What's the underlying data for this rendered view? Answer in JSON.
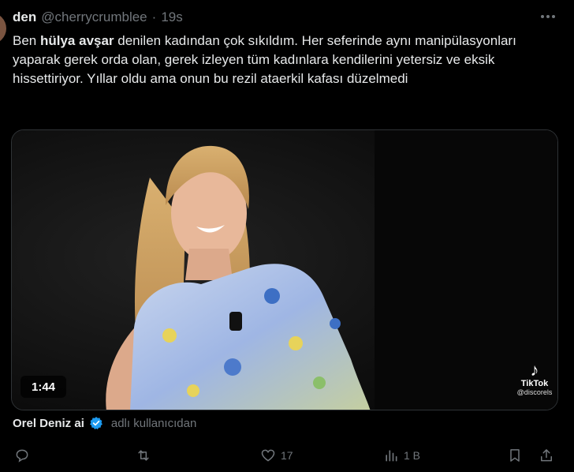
{
  "tweet": {
    "display_name": "den",
    "handle": "@cherrycrumblee",
    "separator": "·",
    "time": "19s",
    "text": {
      "intro": "Ben ",
      "bold_name": "hülya avşar",
      "rest": " denilen kadından çok sıkıldım. Her seferinde aynı manipülasyonları yaparak gerek orda olan, gerek izleyen tüm kadınlara kendilerini yetersiz ve eksik hissettiriyor. Yıllar oldu ama onun bu rezil ataerkil kafası düzelmedi"
    }
  },
  "media": {
    "duration": "1:44",
    "watermark": {
      "logo": "♪",
      "brand": "TikTok",
      "user": "@discorels"
    }
  },
  "credit": {
    "name": "Orel Deniz ai",
    "suffix": "adlı kullanıcıdan"
  },
  "actions": {
    "likes": "17",
    "views": "1 B"
  },
  "colors": {
    "background": "#000000",
    "text": "#e7e9ea",
    "muted": "#71767b",
    "verified": "#1d9bf0"
  }
}
